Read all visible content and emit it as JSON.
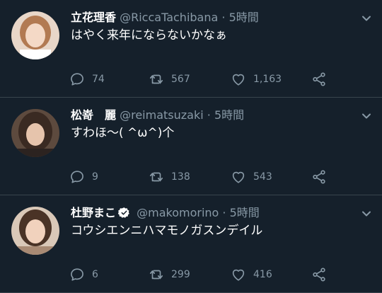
{
  "tweets": [
    {
      "name": "立花理香",
      "handle": "@RiccaTachibana",
      "dot": "·",
      "time": "5時間",
      "verified": false,
      "text": "はやく来年にならないかなぁ",
      "replies": "74",
      "retweets": "567",
      "likes": "1,163"
    },
    {
      "name": "松嵜　麗",
      "handle": "@reimatsuzaki",
      "dot": "·",
      "time": "5時間",
      "verified": false,
      "text": "すわほ〜( ^ω^)个",
      "replies": "9",
      "retweets": "138",
      "likes": "543"
    },
    {
      "name": "杜野まこ",
      "handle": "@makomorino",
      "dot": "·",
      "time": "5時間",
      "verified": true,
      "text": "コウシエンニハマモノガスンデイル",
      "replies": "6",
      "retweets": "299",
      "likes": "416"
    }
  ],
  "colors": {
    "background": "#15202b",
    "muted": "#8899a6",
    "divider": "#38444d",
    "verified": "#ffffff"
  },
  "icons": [
    "chevron-down-icon",
    "reply-icon",
    "retweet-icon",
    "like-icon",
    "share-icon",
    "verified-icon"
  ]
}
